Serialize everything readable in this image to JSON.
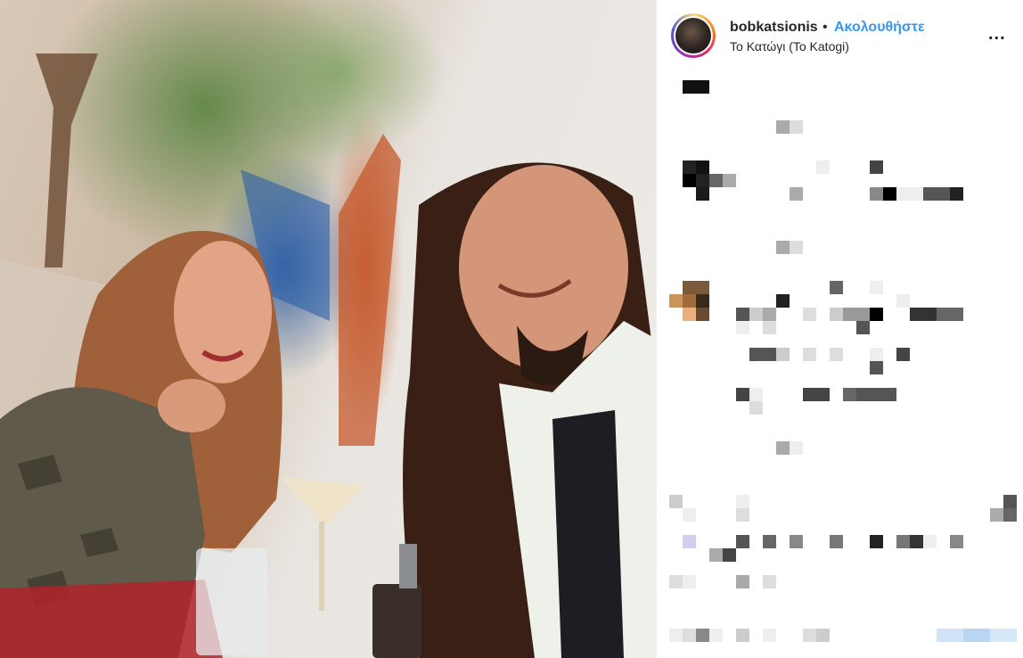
{
  "post": {
    "username": "bobkatsionis",
    "separator": "•",
    "follow_label": "Ακολουθήστε",
    "location": "Το Κατώγι (To Katogi)",
    "more_label": "..."
  },
  "photo": {
    "description_icon": "photo"
  },
  "colors": {
    "follow": "#3897f0",
    "text": "#262626"
  }
}
